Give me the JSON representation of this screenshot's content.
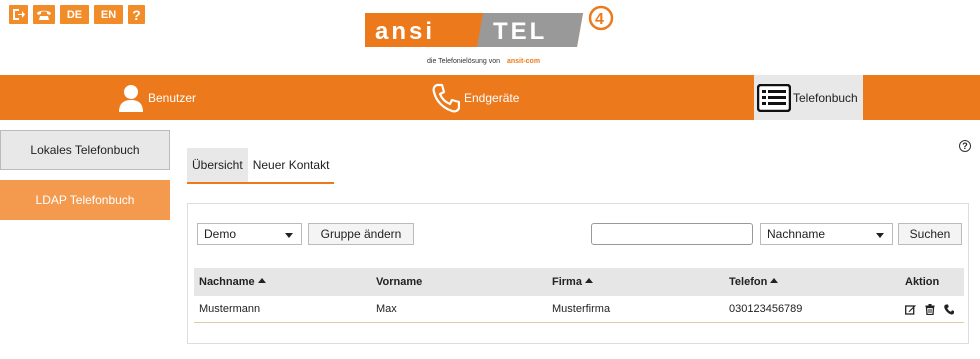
{
  "topbar": {
    "logout_icon": "logout-icon",
    "phone_icon": "phone-handset-icon",
    "lang_de": "DE",
    "lang_en": "EN",
    "help_label": "?"
  },
  "logo": {
    "brand_left": "ansi",
    "brand_right": "TEL",
    "version": "4",
    "tagline": "die Telefonielösung von",
    "tagline_brand": "ansit-com"
  },
  "nav": {
    "users": "Benutzer",
    "devices": "Endgeräte",
    "phonebook": "Telefonbuch"
  },
  "sidebar": {
    "local": "Lokales Telefonbuch",
    "ldap": "LDAP Telefonbuch"
  },
  "help_icon": "?",
  "tabs": {
    "overview": "Übersicht",
    "new_contact": "Neuer Kontakt"
  },
  "toolbar": {
    "group_select": "Demo",
    "change_group": "Gruppe ändern",
    "search_value": "",
    "search_field_select": "Nachname",
    "search_button": "Suchen"
  },
  "table": {
    "columns": [
      "Nachname",
      "Vorname",
      "Firma",
      "Telefon",
      "Aktion"
    ],
    "rows": [
      {
        "nachname": "Mustermann",
        "vorname": "Max",
        "firma": "Musterfirma",
        "telefon": "030123456789"
      }
    ]
  },
  "colors": {
    "accent": "#ec7a1c",
    "accent_light": "#f39a4e",
    "button_bg": "#e8e8e8"
  }
}
